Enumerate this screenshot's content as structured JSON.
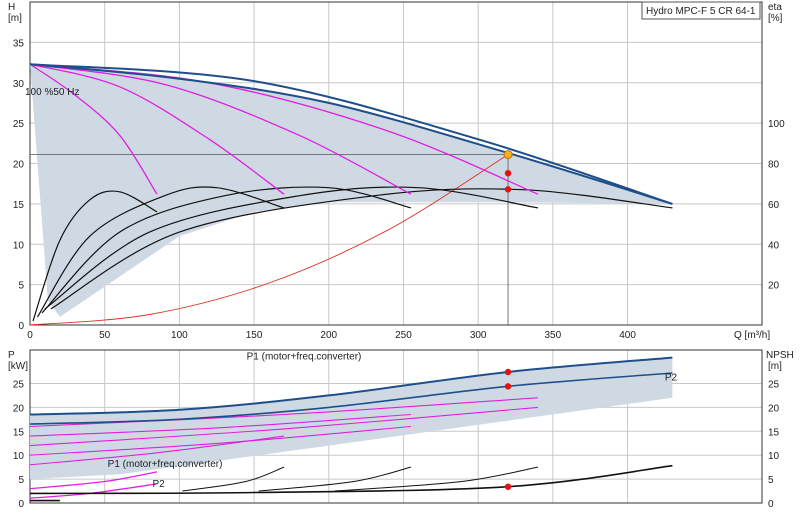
{
  "chart_data": [
    {
      "type": "line",
      "title": "Hydro MPC-F 5 CR 64-1",
      "ylabel_left": "H",
      "ylabel_left_unit": "[m]",
      "ylabel_right": "eta",
      "ylabel_right_unit": "[%]",
      "xlabel": "Q [m³/h]",
      "speed_label": "100 %50 Hz",
      "xlim": [
        0,
        490
      ],
      "ylim_left": [
        0,
        40
      ],
      "ylim_right": [
        0,
        160
      ],
      "x_ticks": [
        "0",
        "50",
        "100",
        "150",
        "200",
        "250",
        "300",
        "350",
        "400"
      ],
      "x_tick_values": [
        0,
        50,
        100,
        150,
        200,
        250,
        300,
        350,
        400
      ],
      "y_ticks_left": [
        0,
        5,
        10,
        15,
        20,
        25,
        30,
        35
      ],
      "y_ticks_right": [
        20,
        40,
        60,
        80,
        100
      ],
      "duty_point": {
        "q": 320,
        "h": 21.1
      },
      "markers_h": [
        {
          "q": 320,
          "h": 21.1
        },
        {
          "q": 320,
          "h": 18.8
        },
        {
          "q": 320,
          "h": 16.8
        }
      ],
      "envelope_max": [
        [
          0,
          32.3
        ],
        [
          100,
          30.5
        ],
        [
          200,
          27.5
        ],
        [
          320,
          21.3
        ],
        [
          430,
          15.0
        ]
      ],
      "envelope_min": [
        [
          430,
          15.0
        ],
        [
          320,
          15.2
        ],
        [
          200,
          15.2
        ],
        [
          150,
          14.0
        ],
        [
          100,
          11.0
        ],
        [
          60,
          6.0
        ],
        [
          20,
          1.0
        ],
        [
          12,
          3.0
        ]
      ],
      "head_curves_pumps": [
        {
          "pumps": 1,
          "points": [
            [
              0,
              32.3
            ],
            [
              30,
              28.5
            ],
            [
              60,
              23.5
            ],
            [
              85,
              16.2
            ]
          ]
        },
        {
          "pumps": 2,
          "points": [
            [
              0,
              32.3
            ],
            [
              60,
              29.5
            ],
            [
              120,
              23.0
            ],
            [
              170,
              16.2
            ]
          ]
        },
        {
          "pumps": 3,
          "points": [
            [
              0,
              32.3
            ],
            [
              90,
              29.8
            ],
            [
              180,
              23.5
            ],
            [
              255,
              16.2
            ]
          ]
        },
        {
          "pumps": 4,
          "points": [
            [
              0,
              32.3
            ],
            [
              120,
              30.0
            ],
            [
              240,
              24.0
            ],
            [
              340,
              16.2
            ]
          ]
        },
        {
          "pumps": 5,
          "points": [
            [
              0,
              32.3
            ],
            [
              150,
              30.2
            ],
            [
              300,
              23.0
            ],
            [
              430,
              15.0
            ]
          ]
        }
      ],
      "system_curve": [
        [
          0,
          0
        ],
        [
          80,
          1.3
        ],
        [
          160,
          5.2
        ],
        [
          240,
          11.8
        ],
        [
          320,
          21.1
        ]
      ],
      "eta_curves": [
        {
          "points": [
            [
              2,
              2
            ],
            [
              20,
              42
            ],
            [
              40,
              62
            ],
            [
              60,
              66
            ],
            [
              85,
              56
            ]
          ]
        },
        {
          "points": [
            [
              5,
              4
            ],
            [
              40,
              44
            ],
            [
              90,
              64
            ],
            [
              125,
              68
            ],
            [
              170,
              58
            ]
          ]
        },
        {
          "points": [
            [
              8,
              6
            ],
            [
              60,
              46
            ],
            [
              130,
              64
            ],
            [
              200,
              68
            ],
            [
              255,
              58
            ]
          ]
        },
        {
          "points": [
            [
              10,
              8
            ],
            [
              80,
              46
            ],
            [
              180,
              64
            ],
            [
              260,
              68
            ],
            [
              340,
              58
            ]
          ]
        },
        {
          "points": [
            [
              14,
              8
            ],
            [
              100,
              46
            ],
            [
              230,
              64
            ],
            [
              330,
              67
            ],
            [
              430,
              58
            ]
          ]
        }
      ]
    },
    {
      "type": "line",
      "ylabel_left": "P",
      "ylabel_left_unit": "[kW]",
      "ylabel_right": "NPSH",
      "ylabel_right_unit": "[m]",
      "xlim": [
        0,
        490
      ],
      "ylim": [
        0,
        32
      ],
      "y_ticks": [
        0,
        5,
        10,
        15,
        20,
        25
      ],
      "series_labels": [
        {
          "text": "P1 (motor+freq.converter)",
          "q": 145,
          "p": 30.0
        },
        {
          "text": "P2",
          "q": 425,
          "p": 25.6
        },
        {
          "text": "P1 (motor+freq.converter)",
          "q": 52,
          "p": 7.5
        },
        {
          "text": "P2",
          "q": 82,
          "p": 3.3
        }
      ],
      "markers_p": [
        {
          "q": 320,
          "p": 27.4
        },
        {
          "q": 320,
          "p": 24.4
        },
        {
          "q": 320,
          "p": 3.4
        }
      ],
      "p1_curve": [
        [
          0,
          18.5
        ],
        [
          100,
          19.5
        ],
        [
          200,
          22.5
        ],
        [
          320,
          27.4
        ],
        [
          430,
          30.4
        ]
      ],
      "p2_curve": [
        [
          0,
          16.5
        ],
        [
          100,
          17.5
        ],
        [
          200,
          20.0
        ],
        [
          320,
          24.4
        ],
        [
          430,
          27.2
        ]
      ],
      "npsh_curve": [
        [
          0,
          2.0
        ],
        [
          150,
          2.2
        ],
        [
          320,
          3.4
        ],
        [
          430,
          7.8
        ]
      ]
    }
  ]
}
